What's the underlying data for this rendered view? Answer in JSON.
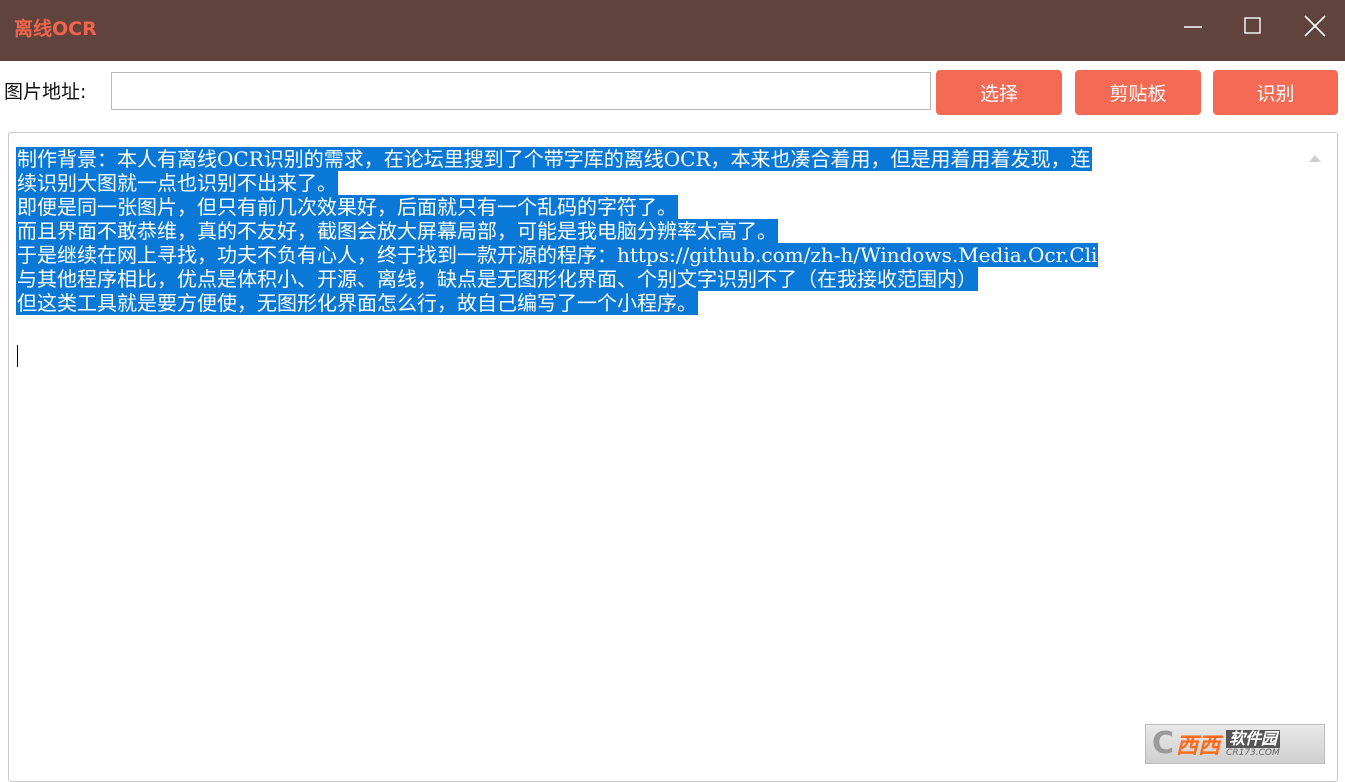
{
  "window": {
    "title": "离线OCR",
    "controls": [
      "minimize-icon",
      "maximize-icon",
      "close-icon"
    ]
  },
  "toolbar": {
    "path_label": "图片地址:",
    "path_value": "",
    "select_label": "选择",
    "clipboard_label": "剪贴板",
    "recognize_label": "识别"
  },
  "result": {
    "lines": [
      "制作背景：本人有离线OCR识别的需求，在论坛里搜到了个带字库的离线OCR，本来也凑合着用，但是用着用着发现，连",
      "续识别大图就一点也识别不出来了。",
      "即便是同一张图片，但只有前几次效果好，后面就只有一个乱码的字符了。",
      "而且界面不敢恭维，真的不友好，截图会放大屏幕局部，可能是我电脑分辨率太高了。",
      "于是继续在网上寻找，功夫不负有心人，终于找到一款开源的程序：https://github.com/zh-h/Windows.Media.Ocr.Cli",
      "与其他程序相比，优点是体积小、开源、离线，缺点是无图形化界面、个别文字识别不了（在我接收范围内）",
      "但这类工具就是要方便使，无图形化界面怎么行，故自己编写了一个小程序。"
    ]
  },
  "watermark": {
    "brand": "西西",
    "soft": "软件园",
    "site": "CR173.COM"
  },
  "colors": {
    "titlebar": "#5f433c",
    "title_text": "#f0644c",
    "button": "#f46a55",
    "selection": "#0a78d7"
  }
}
